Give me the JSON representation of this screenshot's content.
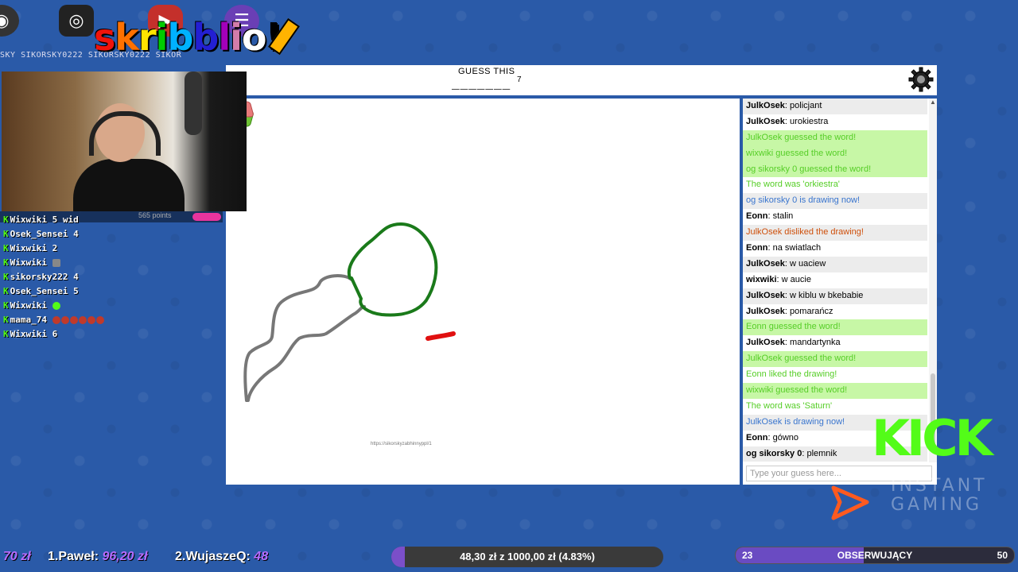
{
  "colors": {
    "background": "#2a5aa8",
    "kick_green": "#53fc18",
    "guessed_green": "#56ce27",
    "drawing_blue": "#3975ce",
    "disliked_orange": "#ce4f0a"
  },
  "overlay": {
    "handles": "SKY    SIKORSKY0222  SIKORSKY0222  SIKOR",
    "logo_letters": [
      "s",
      "k",
      "r",
      "i",
      "b",
      "b",
      "l",
      "i",
      "o"
    ],
    "logo_suffix": "!",
    "score_points": "565 points"
  },
  "kick_chat": [
    {
      "user": "Wixwiki",
      "text": "5 wid",
      "emotes": 0
    },
    {
      "user": "Osek_Sensei",
      "text": "4",
      "emotes": 0
    },
    {
      "user": "Wixwiki",
      "text": "2",
      "emotes": 0
    },
    {
      "user": "Wixwiki",
      "text": "",
      "emotes": 1
    },
    {
      "user": "sikorsky222",
      "text": "4",
      "emotes": 0
    },
    {
      "user": "Osek_Sensei",
      "text": "5",
      "emotes": 0
    },
    {
      "user": "Wixwiki",
      "text": "",
      "emotes": 1
    },
    {
      "user": "mama_74",
      "text": "",
      "emotes": 6
    },
    {
      "user": "Wixwiki",
      "text": "6",
      "emotes": 0
    }
  ],
  "game": {
    "guess_label": "GUESS THIS",
    "word_blanks": "_______",
    "word_length": "7",
    "canvas_url": "https://sikorskyzabhinnyppl/1",
    "guess_placeholder": "Type your guess here..."
  },
  "chat_messages": [
    {
      "name": "JulkOsek",
      "text": "policjant",
      "type": "normal"
    },
    {
      "name": "JulkOsek",
      "text": "urokiestra",
      "type": "normal"
    },
    {
      "name": "",
      "text": "JulkOsek guessed the word!",
      "type": "guessed"
    },
    {
      "name": "",
      "text": "wixwiki guessed the word!",
      "type": "guessed"
    },
    {
      "name": "",
      "text": "og sikorsky 0 guessed the word!",
      "type": "guessed"
    },
    {
      "name": "",
      "text": "The word was 'orkiestra'",
      "type": "green"
    },
    {
      "name": "",
      "text": "og sikorsky 0 is drawing now!",
      "type": "blue"
    },
    {
      "name": "Eonn",
      "text": "stalin",
      "type": "normal"
    },
    {
      "name": "",
      "text": "JulkOsek disliked the drawing!",
      "type": "red"
    },
    {
      "name": "Eonn",
      "text": "na swiatlach",
      "type": "normal"
    },
    {
      "name": "JulkOsek",
      "text": "w uaciew",
      "type": "normal"
    },
    {
      "name": "wixwiki",
      "text": "w aucie",
      "type": "normal"
    },
    {
      "name": "JulkOsek",
      "text": "w kiblu w bkebabie",
      "type": "normal"
    },
    {
      "name": "JulkOsek",
      "text": "pomarańcz",
      "type": "normal"
    },
    {
      "name": "",
      "text": "Eonn guessed the word!",
      "type": "guessed"
    },
    {
      "name": "JulkOsek",
      "text": "mandartynka",
      "type": "normal"
    },
    {
      "name": "",
      "text": "JulkOsek guessed the word!",
      "type": "guessed"
    },
    {
      "name": "",
      "text": "Eonn liked the drawing!",
      "type": "green"
    },
    {
      "name": "",
      "text": "wixwiki guessed the word!",
      "type": "guessed"
    },
    {
      "name": "",
      "text": "The word was 'Saturn'",
      "type": "green"
    },
    {
      "name": "",
      "text": "JulkOsek is drawing now!",
      "type": "blue"
    },
    {
      "name": "Eonn",
      "text": "gówno",
      "type": "normal"
    },
    {
      "name": "og sikorsky 0",
      "text": "plemnik",
      "type": "normal"
    }
  ],
  "sponsors": {
    "kick": "KICK",
    "instant_gaming": "INSTANT GAMING"
  },
  "bottom": {
    "donor0": {
      "rank": "",
      "name": "",
      "amount": "70 zł"
    },
    "donor1": {
      "rank": "1.",
      "name": "Paweł:",
      "amount": "96,20 zł"
    },
    "donor2": {
      "rank": "2.",
      "name": "WujaszeQ:",
      "amount": "48"
    },
    "goal_text": "48,30 zł z 1000,00 zł (4.83%)",
    "goal_fraction": 0.0483,
    "followers_count": "23",
    "followers_label": "OBSERWUJĄCY",
    "followers_goal": "50",
    "followers_fraction": 0.46
  }
}
